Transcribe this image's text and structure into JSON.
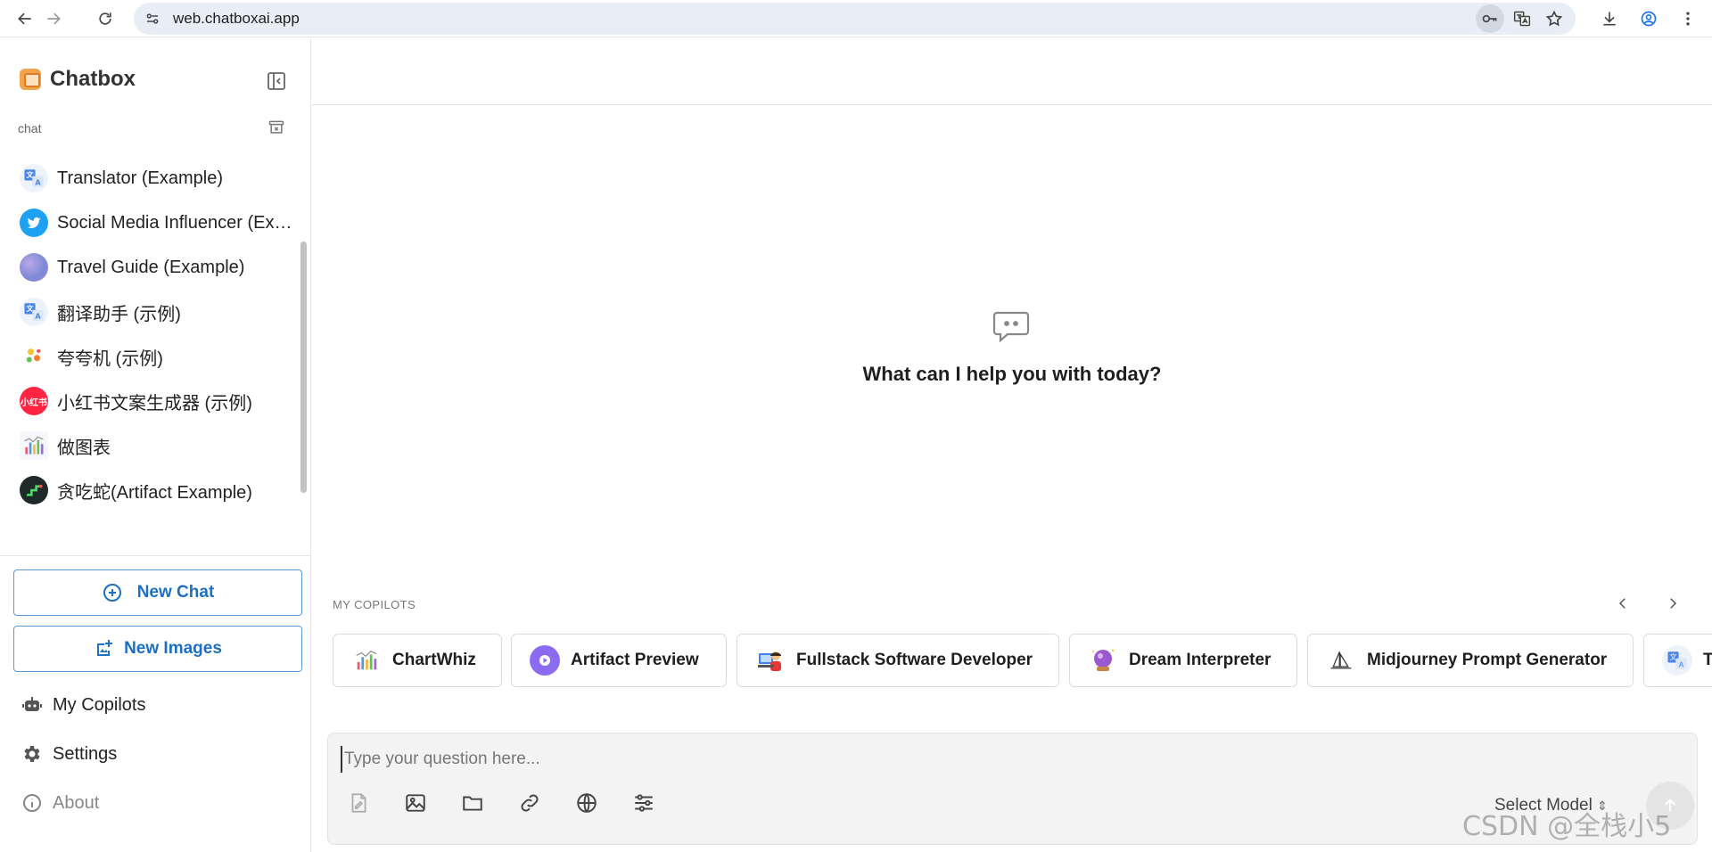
{
  "browser": {
    "url": "web.chatboxai.app"
  },
  "app": {
    "name": "Chatbox",
    "section_label": "chat"
  },
  "sessions": [
    {
      "label": "Translator (Example)",
      "icon": "translate-icon"
    },
    {
      "label": "Social Media Influencer (Example)",
      "icon": "twitter-icon"
    },
    {
      "label": "Travel Guide (Example)",
      "icon": "globe-icon"
    },
    {
      "label": "翻译助手 (示例)",
      "icon": "translate-icon"
    },
    {
      "label": "夸夸机 (示例)",
      "icon": "flower-icon"
    },
    {
      "label": "小红书文案生成器 (示例)",
      "icon": "xiaohongshu-icon",
      "avatar_text": "小红书"
    },
    {
      "label": "做图表",
      "icon": "chart-icon"
    },
    {
      "label": "贪吃蛇(Artifact Example)",
      "icon": "snake-game-icon"
    }
  ],
  "actions": {
    "new_chat": "New Chat",
    "new_images": "New Images",
    "my_copilots": "My Copilots",
    "settings": "Settings",
    "about": "About"
  },
  "main": {
    "empty_title": "What can I help you with today?",
    "copilots_label": "MY COPILOTS",
    "copilots": [
      {
        "name": "ChartWhiz",
        "icon": "chart-icon"
      },
      {
        "name": "Artifact Preview",
        "icon": "play-icon"
      },
      {
        "name": "Fullstack Software Developer",
        "icon": "developer-icon"
      },
      {
        "name": "Dream Interpreter",
        "icon": "crystal-ball-icon"
      },
      {
        "name": "Midjourney Prompt Generator",
        "icon": "sailboat-icon"
      },
      {
        "name": "T",
        "icon": "translate-icon"
      }
    ]
  },
  "composer": {
    "placeholder": "Type your question here...",
    "model_label": "Select Model"
  },
  "watermark": "CSDN @全栈小5",
  "colors": {
    "accent": "#1d6fc1",
    "accent_border": "#5b9bd5",
    "twitter": "#1da1f2",
    "xiaohongshu": "#ff2442"
  }
}
